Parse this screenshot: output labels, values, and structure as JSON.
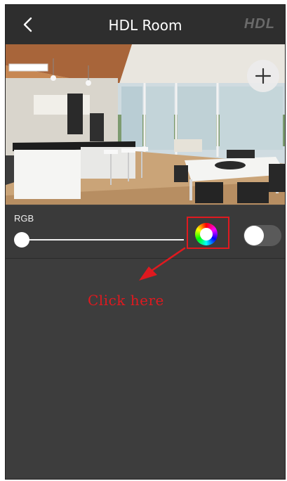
{
  "header": {
    "title": "HDL Room",
    "brand": "HDL",
    "back_icon": "chevron-left-icon"
  },
  "room": {
    "add_icon": "plus-icon"
  },
  "rgb_control": {
    "label": "RGB",
    "slider_value": 0,
    "color_wheel_icon": "color-wheel-icon",
    "toggle_on": false
  },
  "annotation": {
    "text": "Click here",
    "color": "#e0191f"
  }
}
